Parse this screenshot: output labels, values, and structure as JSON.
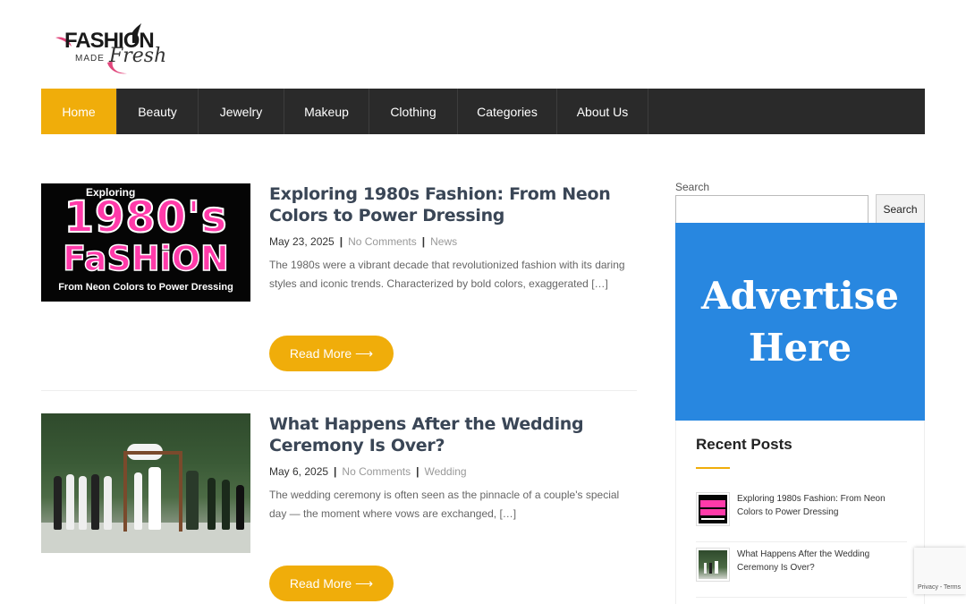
{
  "logo": {
    "word1": "FASHI",
    "word2": "N",
    "made": "MADE",
    "fresh": "Fresh"
  },
  "nav": {
    "items": [
      {
        "label": "Home",
        "active": true
      },
      {
        "label": "Beauty"
      },
      {
        "label": "Jewelry"
      },
      {
        "label": "Makeup"
      },
      {
        "label": "Clothing"
      },
      {
        "label": "Categories"
      },
      {
        "label": "About Us"
      }
    ]
  },
  "posts": [
    {
      "title": "Exploring 1980s Fashion: From Neon Colors to Power Dressing",
      "date": "May 23, 2025",
      "comments": "No Comments",
      "category": "News",
      "excerpt": "The 1980s were a vibrant decade that revolutionized fashion with its daring styles and iconic trends. Characterized by bold colors, exaggerated […]",
      "read_more": "Read More ⟶",
      "thumb": {
        "explore": "Exploring",
        "year": "1980's",
        "word": "FaSHiON",
        "sub": "From Neon Colors to Power Dressing"
      }
    },
    {
      "title": "What Happens After the Wedding Ceremony Is Over?",
      "date": "May 6, 2025",
      "comments": "No Comments",
      "category": "Wedding",
      "excerpt": "The wedding ceremony is often seen as the pinnacle of a couple's special day — the moment where vows are exchanged, […]",
      "read_more": "Read More ⟶"
    }
  ],
  "sidebar": {
    "search_label": "Search",
    "search_placeholder": "",
    "search_button": "Search",
    "ad": {
      "line1": "Advertise",
      "line2": "Here",
      "color": "#2887e0"
    },
    "recent_title": "Recent Posts",
    "recent": [
      {
        "title": "Exploring 1980s Fashion: From Neon Colors to Power Dressing"
      },
      {
        "title": "What Happens After the Wedding Ceremony Is Over?"
      }
    ]
  },
  "recaptcha": {
    "text": "Privacy - Terms"
  },
  "colors": {
    "accent": "#f0ad0a",
    "nav_bg": "#2a2a2a",
    "title": "#3a4656"
  }
}
